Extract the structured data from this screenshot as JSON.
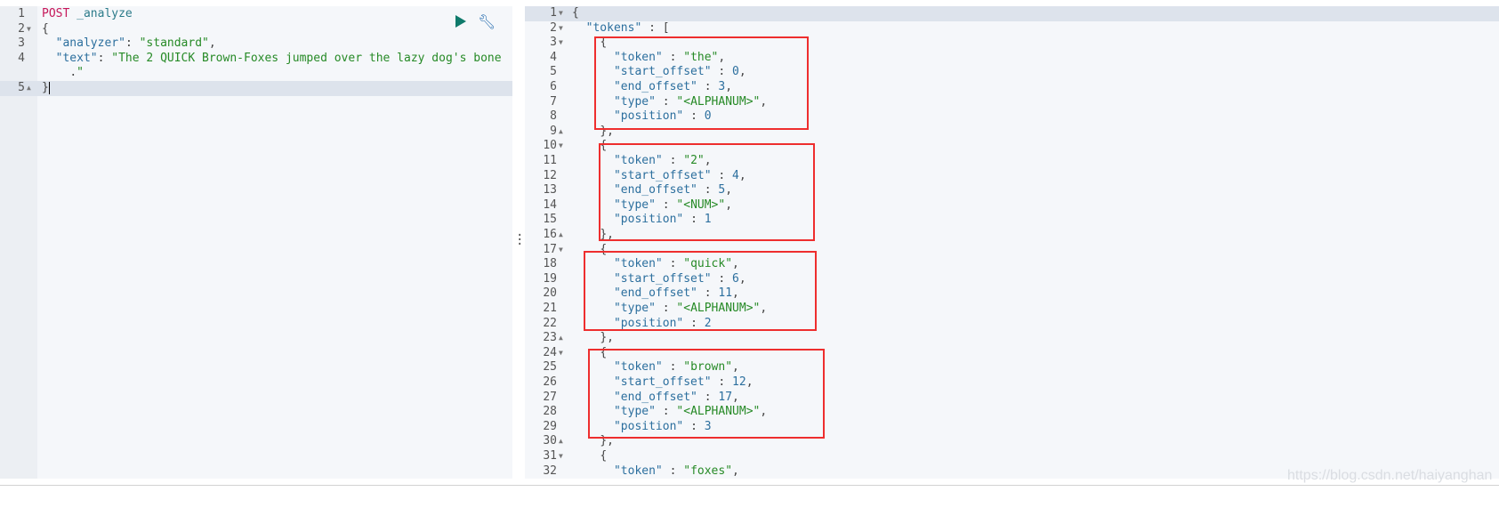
{
  "request": {
    "lines": [
      {
        "num": "1",
        "text": "POST _analyze"
      },
      {
        "num": "2",
        "text": "{",
        "fold": "down"
      },
      {
        "num": "3",
        "text": "  \"analyzer\": \"standard\","
      },
      {
        "num": "4",
        "text": "  \"text\": \"The 2 QUICK Brown-Foxes jumped over the lazy dog's bone"
      },
      {
        "num": "",
        "text": "    .\""
      },
      {
        "num": "5",
        "text": "}",
        "fold": "up",
        "active": true
      }
    ],
    "run_icon": "play-icon",
    "settings_icon": "wrench-icon"
  },
  "response": {
    "lines": [
      {
        "num": "1",
        "text": "{",
        "fold": "down",
        "active": true
      },
      {
        "num": "2",
        "text": "  \"tokens\" : [",
        "fold": "down"
      },
      {
        "num": "3",
        "text": "    {",
        "fold": "down"
      },
      {
        "num": "4",
        "text": "      \"token\" : \"the\","
      },
      {
        "num": "5",
        "text": "      \"start_offset\" : 0,"
      },
      {
        "num": "6",
        "text": "      \"end_offset\" : 3,"
      },
      {
        "num": "7",
        "text": "      \"type\" : \"<ALPHANUM>\","
      },
      {
        "num": "8",
        "text": "      \"position\" : 0"
      },
      {
        "num": "9",
        "text": "    },",
        "fold": "up"
      },
      {
        "num": "10",
        "text": "    {",
        "fold": "down"
      },
      {
        "num": "11",
        "text": "      \"token\" : \"2\","
      },
      {
        "num": "12",
        "text": "      \"start_offset\" : 4,"
      },
      {
        "num": "13",
        "text": "      \"end_offset\" : 5,"
      },
      {
        "num": "14",
        "text": "      \"type\" : \"<NUM>\","
      },
      {
        "num": "15",
        "text": "      \"position\" : 1"
      },
      {
        "num": "16",
        "text": "    },",
        "fold": "up"
      },
      {
        "num": "17",
        "text": "    {",
        "fold": "down"
      },
      {
        "num": "18",
        "text": "      \"token\" : \"quick\","
      },
      {
        "num": "19",
        "text": "      \"start_offset\" : 6,"
      },
      {
        "num": "20",
        "text": "      \"end_offset\" : 11,"
      },
      {
        "num": "21",
        "text": "      \"type\" : \"<ALPHANUM>\","
      },
      {
        "num": "22",
        "text": "      \"position\" : 2"
      },
      {
        "num": "23",
        "text": "    },",
        "fold": "up"
      },
      {
        "num": "24",
        "text": "    {",
        "fold": "down"
      },
      {
        "num": "25",
        "text": "      \"token\" : \"brown\","
      },
      {
        "num": "26",
        "text": "      \"start_offset\" : 12,"
      },
      {
        "num": "27",
        "text": "      \"end_offset\" : 17,"
      },
      {
        "num": "28",
        "text": "      \"type\" : \"<ALPHANUM>\","
      },
      {
        "num": "29",
        "text": "      \"position\" : 3"
      },
      {
        "num": "30",
        "text": "    },",
        "fold": "up"
      },
      {
        "num": "31",
        "text": "    {",
        "fold": "down"
      },
      {
        "num": "32",
        "text": "      \"token\" : \"foxes\","
      }
    ]
  },
  "watermark": "https://blog.csdn.net/haiyanghan",
  "colors": {
    "highlight_box": "#ee2e2e",
    "run": "#0f7a6b",
    "key": "#2c6f9e",
    "string": "#268a26",
    "method": "#c6185a"
  }
}
